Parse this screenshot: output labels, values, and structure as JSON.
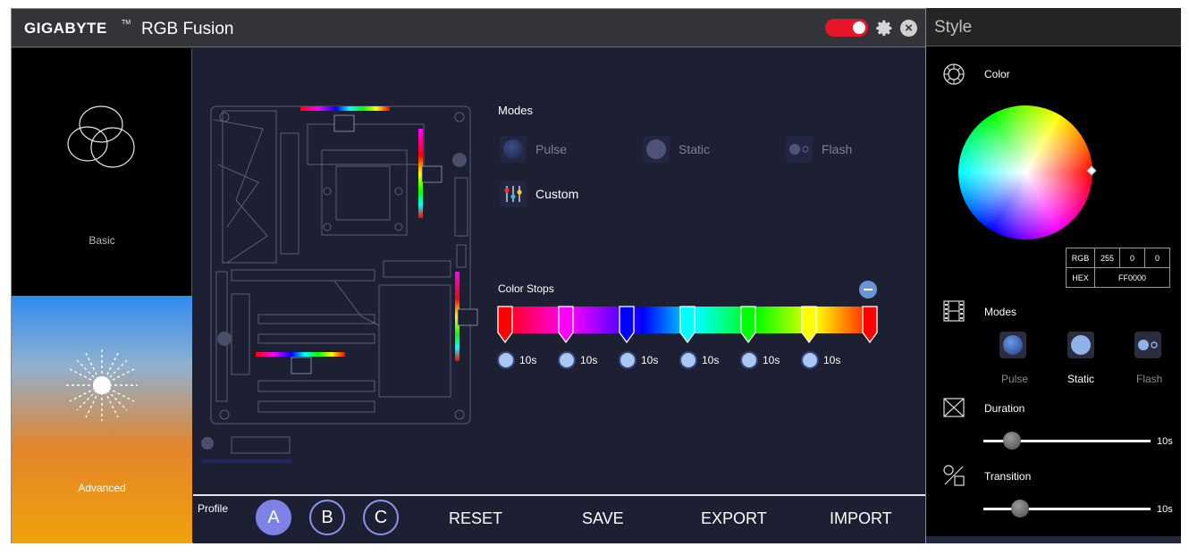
{
  "app": {
    "brand": "GIGABYTE",
    "trademark": "TM",
    "title": "RGB Fusion",
    "power_on": true
  },
  "nav": {
    "basic_label": "Basic",
    "advanced_label": "Advanced"
  },
  "modes": {
    "label": "Modes",
    "items": [
      {
        "label": "Pulse",
        "enabled": false
      },
      {
        "label": "Static",
        "enabled": false
      },
      {
        "label": "Flash",
        "enabled": false
      },
      {
        "label": "Custom",
        "enabled": true
      }
    ]
  },
  "color_stops": {
    "label": "Color Stops",
    "stops": [
      {
        "color": "#ff0000",
        "time": "10s"
      },
      {
        "color": "#ff00ff",
        "time": "10s"
      },
      {
        "color": "#0000ff",
        "time": "10s"
      },
      {
        "color": "#00ffff",
        "time": "10s"
      },
      {
        "color": "#00ff00",
        "time": "10s"
      },
      {
        "color": "#ffff00",
        "time": "10s"
      },
      {
        "color": "#ff0000",
        "time": ""
      }
    ]
  },
  "bottom": {
    "profile_label": "Profile",
    "profiles": [
      "A",
      "B",
      "C"
    ],
    "active_profile": "A",
    "actions": [
      "RESET",
      "SAVE",
      "EXPORT",
      "IMPORT"
    ]
  },
  "style": {
    "title": "Style",
    "color_label": "Color",
    "rgb": {
      "label": "RGB",
      "r": "255",
      "g": "0",
      "b": "0"
    },
    "hex": {
      "label": "HEX",
      "value": "FF0000"
    },
    "modes_label": "Modes",
    "modes": [
      {
        "label": "Pulse",
        "selected": false
      },
      {
        "label": "Static",
        "selected": true
      },
      {
        "label": "Flash",
        "selected": false
      }
    ],
    "duration": {
      "label": "Duration",
      "value": "10s",
      "level": 0.17
    },
    "transition": {
      "label": "Transition",
      "value": "10s",
      "level": 0.22
    }
  },
  "colors": {
    "accent": "#7c82e6",
    "power": "#e8152a",
    "background": "#1d1f33"
  }
}
